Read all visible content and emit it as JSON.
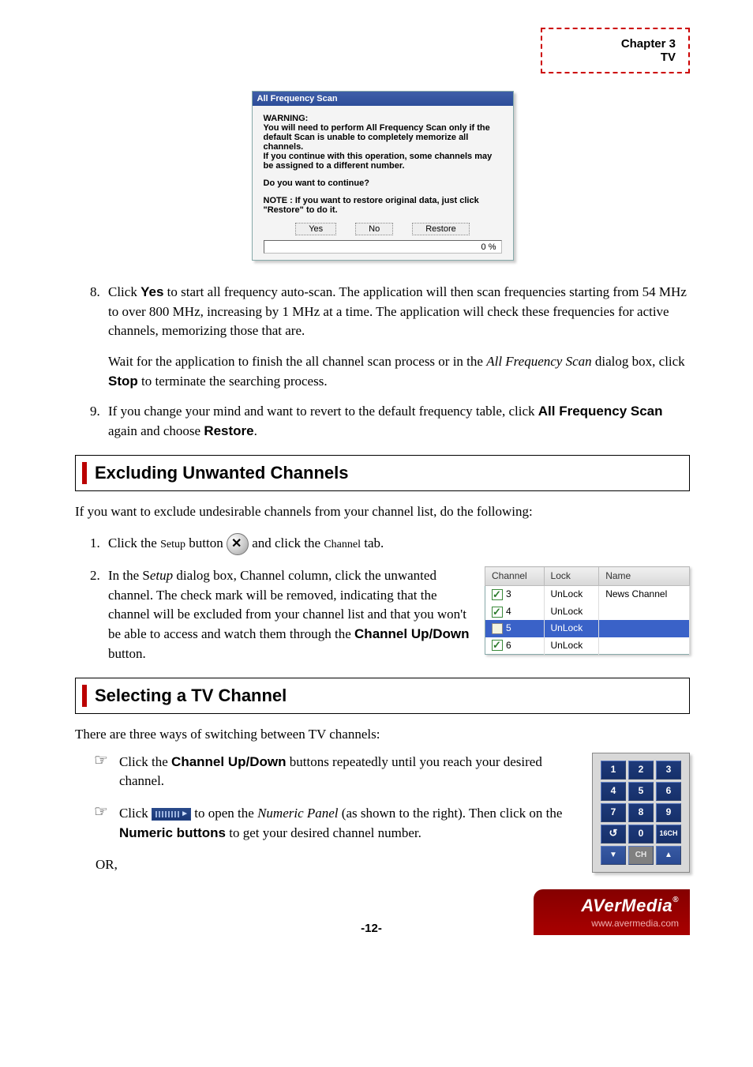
{
  "chapter": {
    "title": "Chapter 3",
    "sub": "TV"
  },
  "dialog": {
    "title": "All Frequency Scan",
    "warning_label": "WARNING:",
    "line1": "You will need to perform All Frequency Scan only if the default Scan is unable to completely memorize all channels.",
    "line2": "If you continue with this operation, some channels may be assigned to a different number.",
    "continue_q": "Do you want to continue?",
    "note": "NOTE : If you want to restore original data, just click \"Restore\" to do it.",
    "yes": "Yes",
    "no": "No",
    "restore": "Restore",
    "progress": "0 %"
  },
  "step8": {
    "p1a": "Click ",
    "p1b": "Yes",
    "p1c": " to start all frequency auto-scan. The application will then scan frequencies starting from 54 MHz to over 800 MHz, increasing by 1 MHz at a time. The application will check these frequencies for active channels, memorizing those that are.",
    "p2a": "Wait for the application to finish the all channel scan process or in the ",
    "p2b": "All Frequency Scan",
    "p2c": " dialog box, click ",
    "p2d": "Stop",
    "p2e": " to terminate the searching process."
  },
  "step9": {
    "a": "If you change your mind and want to revert to the default frequency table, click ",
    "b": "All Frequency Scan",
    "c": " again and choose ",
    "d": "Restore",
    "e": "."
  },
  "sec_exclude": {
    "title": "Excluding Unwanted Channels",
    "intro": "If you want to exclude undesirable channels from your channel list, do the following:",
    "s1a": "Click the ",
    "s1_setup": "Setup",
    "s1b": " button ",
    "s1c": " and click the ",
    "s1_channel": "Channel",
    "s1d": " tab.",
    "s2a": "In the S",
    "s2_etup": "etup",
    "s2b": " dialog box, Channel column, click the unwanted channel. The check mark will be removed, indicating that the channel will be excluded from your channel list and that you won't be able to access and watch them through the ",
    "s2c": "Channel Up/Down",
    "s2d": " button."
  },
  "chan_table": {
    "headers": {
      "channel": "Channel",
      "lock": "Lock",
      "name": "Name"
    },
    "rows": [
      {
        "checked": true,
        "num": "3",
        "lock": "UnLock",
        "name": "News Channel",
        "sel": false
      },
      {
        "checked": true,
        "num": "4",
        "lock": "UnLock",
        "name": "",
        "sel": false
      },
      {
        "checked": false,
        "num": "5",
        "lock": "UnLock",
        "name": "",
        "sel": true
      },
      {
        "checked": true,
        "num": "6",
        "lock": "UnLock",
        "name": "",
        "sel": false
      }
    ]
  },
  "sec_select": {
    "title": "Selecting a TV Channel",
    "intro": "There are three ways of switching between TV channels:",
    "b1a": "Click the ",
    "b1b": "Channel Up/Down",
    "b1c": " buttons repeatedly until you reach your desired channel.",
    "b2a": "Click ",
    "b2b": " to open the ",
    "b2c": "Numeric Panel",
    "b2d": " (as shown to the right). Then click on the ",
    "b2e": "Numeric buttons",
    "b2f": " to get your desired channel number.",
    "or": "OR,"
  },
  "keypad": {
    "keys": [
      [
        "1",
        "2",
        "3"
      ],
      [
        "4",
        "5",
        "6"
      ],
      [
        "7",
        "8",
        "9"
      ],
      [
        "↺",
        "0",
        "16CH"
      ]
    ],
    "ch": "CH",
    "down": "▼",
    "up": "▲"
  },
  "footer": {
    "pagenum": "-12-",
    "brand": "AVerMedia",
    "url": "www.avermedia.com"
  }
}
